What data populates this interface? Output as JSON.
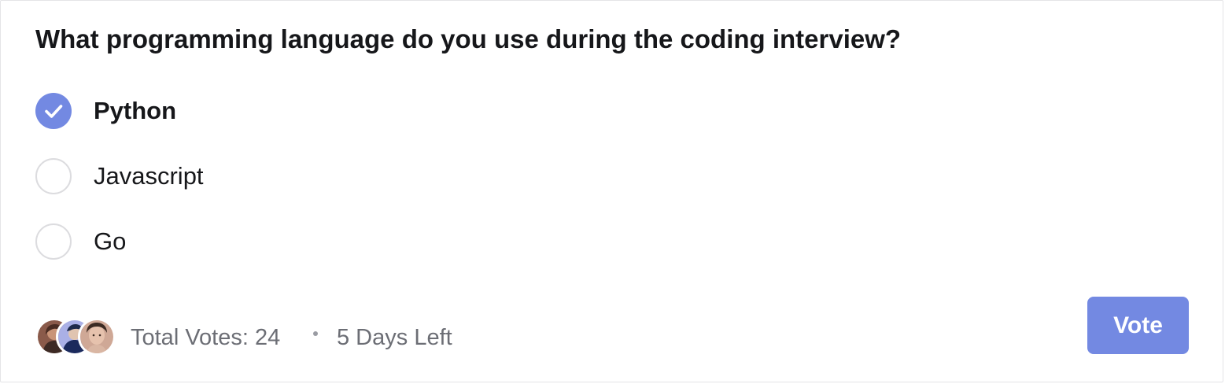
{
  "poll": {
    "question": "What programming language do you use during the coding interview?",
    "options": [
      {
        "label": "Python",
        "selected": true
      },
      {
        "label": "Javascript",
        "selected": false
      },
      {
        "label": "Go",
        "selected": false
      }
    ],
    "total_votes_label": "Total Votes: 24",
    "days_left_label": "5 Days Left",
    "vote_button_label": "Vote"
  },
  "icons": {
    "selected_radio": "check-circle-icon",
    "unselected_radio": "empty-circle-icon",
    "separator": "bullet-dot",
    "voters": "avatar-stack"
  },
  "colors": {
    "accent": "#7389e2",
    "text_primary": "#16171a",
    "text_secondary": "#6c6e75",
    "radio_border": "#dcdcdf"
  }
}
